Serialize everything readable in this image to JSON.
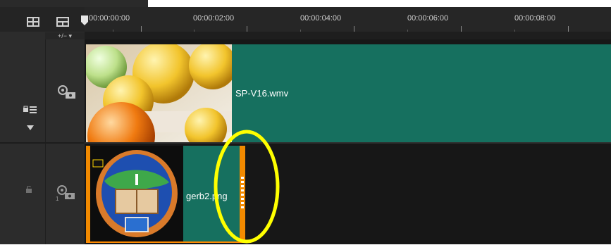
{
  "toolbar": {
    "add_remove_label": "+/− ▾"
  },
  "ruler": {
    "timecodes": [
      "00:00:00:00",
      "00:00:02:00",
      "00:00:04:00",
      "00:00:06:00",
      "00:00:08:00"
    ]
  },
  "tracks": {
    "video": {
      "clip_name": "SP-V16.wmv"
    },
    "overlay": {
      "clip_name": "gerb2.png",
      "track_number": "1"
    }
  },
  "colors": {
    "clip_fill": "#16705f",
    "clip_handle": "#f28a00",
    "annotation_ring": "#ffff00"
  }
}
